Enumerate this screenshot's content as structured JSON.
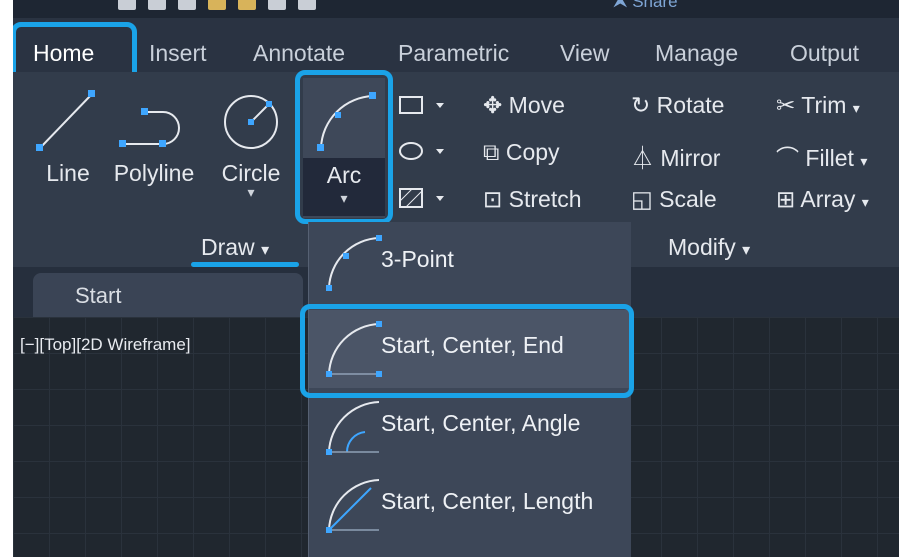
{
  "ribbon": {
    "share_label": "Share",
    "tabs": [
      {
        "label": "Home",
        "active": true
      },
      {
        "label": "Insert"
      },
      {
        "label": "Annotate"
      },
      {
        "label": "Parametric"
      },
      {
        "label": "View"
      },
      {
        "label": "Manage"
      },
      {
        "label": "Output"
      }
    ]
  },
  "draw_panel": {
    "title": "Draw",
    "title_arrow": "▾",
    "tools": {
      "line": "Line",
      "polyline": "Polyline",
      "circle": "Circle",
      "arc": "Arc"
    },
    "expand_arrow": "▾"
  },
  "modify_panel": {
    "title": "Modify",
    "title_arrow": "▾",
    "move": "Move",
    "rotate": "Rotate",
    "trim": "Trim",
    "copy": "Copy",
    "mirror": "Mirror",
    "fillet": "Fillet",
    "stretch": "Stretch",
    "scale": "Scale",
    "array": "Array"
  },
  "file_tabs": {
    "start": "Start"
  },
  "viewport": {
    "label": "[−][Top][2D Wireframe]"
  },
  "arc_menu": {
    "items": [
      {
        "label": "3-Point"
      },
      {
        "label": "Start, Center, End",
        "highlighted": true
      },
      {
        "label": "Start, Center, Angle"
      },
      {
        "label": "Start, Center, Length"
      }
    ]
  },
  "colors": {
    "highlight": "#1aa3e8",
    "ribbon_bg": "#323c4b",
    "menu_bg": "#3d4758",
    "canvas_bg": "#20272f"
  }
}
